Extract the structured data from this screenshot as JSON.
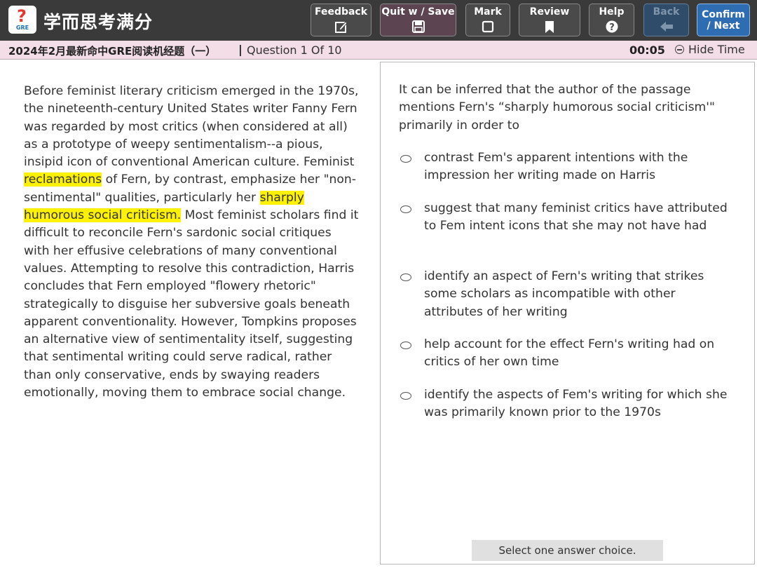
{
  "brand": {
    "logo_glyph": "?",
    "logo_text": "GRE",
    "name": "学而思考满分"
  },
  "toolbar": {
    "feedback": "Feedback",
    "quit_save": "Quit w / Save",
    "mark": "Mark",
    "review": "Review",
    "help": "Help",
    "back": "Back",
    "confirm_line1": "Confirm",
    "confirm_line2": "/ Next"
  },
  "infobar": {
    "exam_title": "2024年2月最新命中GRE阅读机经题（一）",
    "separator": "|",
    "question_counter": "Question 1 Of 10",
    "timer": "00:05",
    "hide_time": "Hide Time"
  },
  "passage": {
    "before_hl1": "Before feminist literary criticism emerged in the 1970s, the nineteenth-century United States writer Fanny Fern was regarded by most critics (when considered at all) as a prototype of weepy sentimentalism--a pious, insipid icon of conventional American culture. Feminist ",
    "hl1": "reclamations",
    "between": " of Fern, by contrast, emphasize her \"non-sentimental\" qualities, particularly her ",
    "hl2": "sharply humorous social criticism.",
    "after_hl2": " Most feminist scholars find it difficult to reconcile Fern's sardonic social critiques with her effusive celebrations of many conventional values. Attempting to resolve this contradiction, Harris concludes that Fern employed \"flowery rhetoric\" strategically to disguise her subversive goals beneath apparent conventionality. However, Tompkins proposes an alternative view of sentimentality itself, suggesting that sentimental writing could serve radical, rather than only conservative, ends by swaying readers emotionally, moving them to embrace social change."
  },
  "question": {
    "stem": "It can be inferred that the author of the passage mentions Fern's “sharply humorous social criticism'\" primarily in order to",
    "choices": [
      "contrast Fem's apparent intentions with the impression her writing made on Harris",
      "suggest that many feminist critics have attributed to Fem intent icons that she may not have had",
      "identify an aspect of Fern's writing that strikes some scholars as incompatible with other attributes of her writing",
      "help account for the effect Fern's writing had on critics of her own time",
      "identify the aspects of Fem's writing for which she was primarily known prior to the 1970s"
    ],
    "status": "Select one answer choice."
  },
  "colors": {
    "toolbar_bg": "#3a3a3a",
    "infobar_bg": "#f3dde6",
    "highlight": "#fff200",
    "confirm_bg": "#2f6db3",
    "back_bg": "#2f4d6b"
  },
  "icons": {
    "feedback": "pencil-square-icon",
    "quit_save": "save-icon",
    "mark": "square-icon",
    "review": "bookmark-icon",
    "help": "question-circle-icon",
    "back": "arrow-left-icon",
    "hide_time": "minus-circle-icon"
  }
}
